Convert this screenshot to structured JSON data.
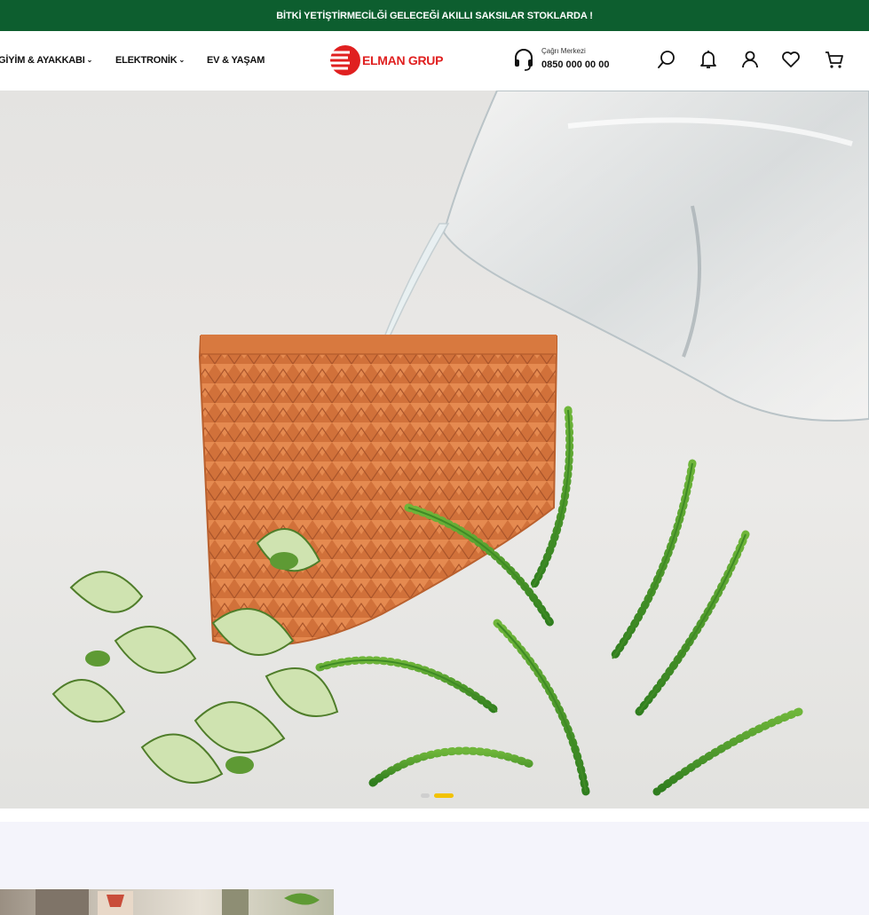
{
  "announcement": "BİTKİ YETİŞTİRMECİLĞİ GELECEĞİ AKILLI SAKSILAR STOKLARDA !",
  "nav": {
    "items": [
      {
        "label": "GİYİM & AYAKKABI",
        "dropdown": true
      },
      {
        "label": "ELEKTRONİK",
        "dropdown": true
      },
      {
        "label": "EV & YAŞAM",
        "dropdown": false
      }
    ],
    "chevron": "⌄"
  },
  "logo": {
    "text": "ELMAN GRUP",
    "color": "#e02020"
  },
  "call_center": {
    "label": "Çağrı Merkezi",
    "phone": "0850 000 00 00",
    "icon": "headset-icon"
  },
  "header_icons": [
    "search-icon",
    "bell-icon",
    "user-icon",
    "heart-icon",
    "cart-icon"
  ],
  "hero": {
    "slides_total": 2,
    "active_slide": 2,
    "image": "terracotta-pot-with-plants"
  },
  "colors": {
    "topbar_bg": "#0d5e2f",
    "accent": "#f2c200",
    "brand_red": "#e02020"
  }
}
